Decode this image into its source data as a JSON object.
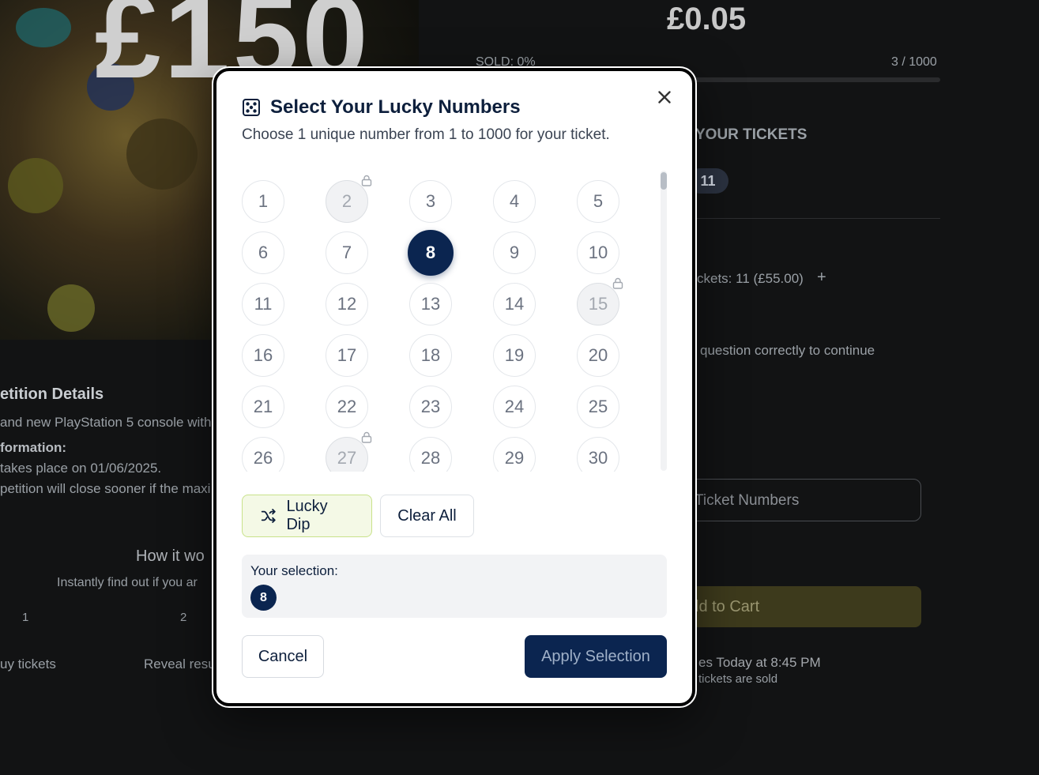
{
  "background": {
    "hero_text": "£150",
    "price": "£0.05",
    "sold_label": "SOLD: 0%",
    "sold_count": "3 / 1000",
    "your_tickets_heading": "YOUR TICKETS",
    "tickets_pill": "11",
    "tickets_line": "ckets: 11 (£55.00)",
    "plus_symbol": "+",
    "question_note": "question correctly to continue",
    "ticket_numbers_button": "Ticket Numbers",
    "add_to_cart": "ld to Cart",
    "draw_time": "es Today at 8:45 PM",
    "draw_note": "tickets are sold",
    "details_heading": "etition Details",
    "details_line1": "and new PlayStation 5 console with",
    "info_heading": "formation:",
    "info_line1": "takes place on 01/06/2025.",
    "info_line2": "petition will close sooner if the maxi",
    "how_heading": "How it wo",
    "how_sub": "Instantly find out if you ar",
    "step1_num": "1",
    "step1_label": "uy tickets",
    "step2_num": "2",
    "step2_label": "Reveal resu"
  },
  "modal": {
    "title": "Select Your Lucky Numbers",
    "subtitle": "Choose 1 unique number from 1 to 1000 for your ticket.",
    "numbers": [
      {
        "n": "1",
        "state": "available"
      },
      {
        "n": "2",
        "state": "locked"
      },
      {
        "n": "3",
        "state": "available"
      },
      {
        "n": "4",
        "state": "available"
      },
      {
        "n": "5",
        "state": "available"
      },
      {
        "n": "6",
        "state": "available"
      },
      {
        "n": "7",
        "state": "available"
      },
      {
        "n": "8",
        "state": "selected"
      },
      {
        "n": "9",
        "state": "available"
      },
      {
        "n": "10",
        "state": "available"
      },
      {
        "n": "11",
        "state": "available"
      },
      {
        "n": "12",
        "state": "available"
      },
      {
        "n": "13",
        "state": "available"
      },
      {
        "n": "14",
        "state": "available"
      },
      {
        "n": "15",
        "state": "locked"
      },
      {
        "n": "16",
        "state": "available"
      },
      {
        "n": "17",
        "state": "available"
      },
      {
        "n": "18",
        "state": "available"
      },
      {
        "n": "19",
        "state": "available"
      },
      {
        "n": "20",
        "state": "available"
      },
      {
        "n": "21",
        "state": "available"
      },
      {
        "n": "22",
        "state": "available"
      },
      {
        "n": "23",
        "state": "available"
      },
      {
        "n": "24",
        "state": "available"
      },
      {
        "n": "25",
        "state": "available"
      },
      {
        "n": "26",
        "state": "available"
      },
      {
        "n": "27",
        "state": "locked"
      },
      {
        "n": "28",
        "state": "available"
      },
      {
        "n": "29",
        "state": "available"
      },
      {
        "n": "30",
        "state": "available"
      }
    ],
    "lucky_dip_label": "Lucky Dip",
    "clear_all_label": "Clear All",
    "selection_label": "Your selection:",
    "selected_numbers": [
      "8"
    ],
    "cancel_label": "Cancel",
    "apply_label": "Apply Selection",
    "colors": {
      "primary": "#0b2550",
      "lucky_bg": "#f4f9e6",
      "lucky_border": "#c8e28a",
      "locked_bg": "#f1f2f4"
    },
    "icons": {
      "title": "dice-icon",
      "close": "close-icon",
      "lock": "lock-icon",
      "lucky_dip": "shuffle-icon"
    }
  }
}
